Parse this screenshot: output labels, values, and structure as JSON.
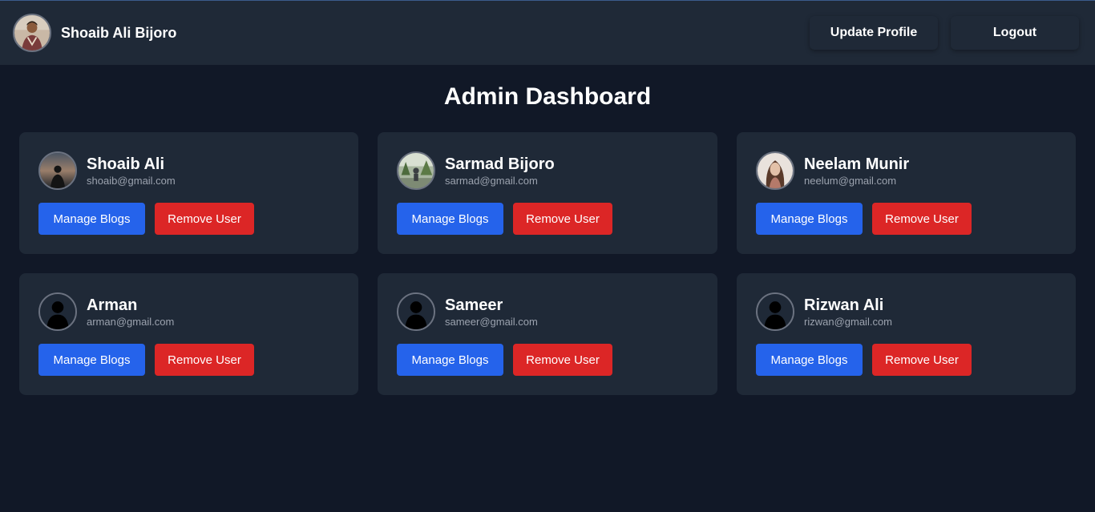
{
  "header": {
    "name": "Shoaib Ali Bijoro",
    "update_label": "Update Profile",
    "logout_label": "Logout"
  },
  "page": {
    "title": "Admin Dashboard"
  },
  "users": [
    {
      "name": "Shoaib Ali",
      "email": "shoaib@gmail.com",
      "avatar": "photo-sunset",
      "manage_label": "Manage Blogs",
      "remove_label": "Remove User"
    },
    {
      "name": "Sarmad Bijoro",
      "email": "sarmad@gmail.com",
      "avatar": "photo-outdoor",
      "manage_label": "Manage Blogs",
      "remove_label": "Remove User"
    },
    {
      "name": "Neelam Munir",
      "email": "neelum@gmail.com",
      "avatar": "photo-portrait",
      "manage_label": "Manage Blogs",
      "remove_label": "Remove User"
    },
    {
      "name": "Arman",
      "email": "arman@gmail.com",
      "avatar": "default-user-silhouette",
      "manage_label": "Manage Blogs",
      "remove_label": "Remove User"
    },
    {
      "name": "Sameer",
      "email": "sameer@gmail.com",
      "avatar": "default-user-silhouette",
      "manage_label": "Manage Blogs",
      "remove_label": "Remove User"
    },
    {
      "name": "Rizwan Ali",
      "email": "rizwan@gmail.com",
      "avatar": "default-user-silhouette",
      "manage_label": "Manage Blogs",
      "remove_label": "Remove User"
    }
  ],
  "colors": {
    "background": "#111827",
    "surface": "#1f2937",
    "primary": "#2563eb",
    "danger": "#dc2626",
    "muted_text": "#9ca3af"
  }
}
